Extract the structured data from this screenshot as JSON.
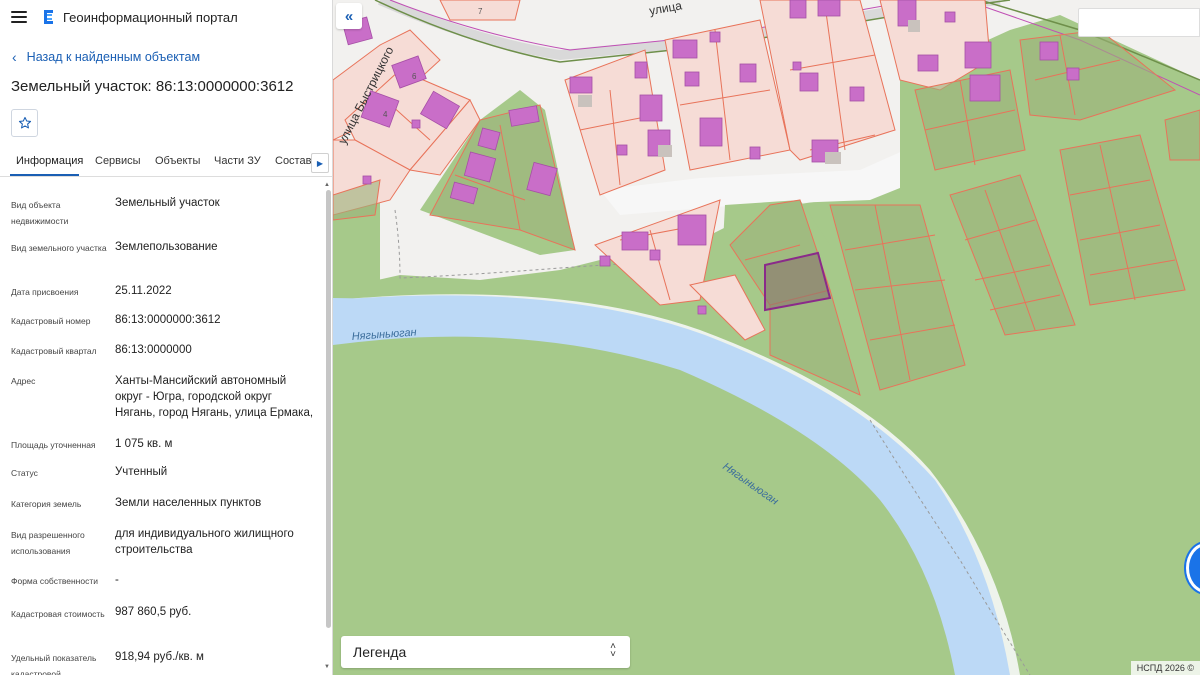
{
  "header": {
    "app_title": "Геоинформационный портал"
  },
  "nav": {
    "back_label": "Назад к найденным объектам"
  },
  "object": {
    "title": "Земельный участок: 86:13:0000000:3612"
  },
  "tabs": [
    {
      "label": "Информация",
      "active": true
    },
    {
      "label": "Сервисы"
    },
    {
      "label": "Объекты"
    },
    {
      "label": "Части ЗУ"
    },
    {
      "label": "Состав"
    }
  ],
  "properties": [
    {
      "label": "Вид объекта недвижимости",
      "value": "Земельный участок"
    },
    {
      "label": "Вид земельного участка",
      "value": "Землепользование"
    },
    {
      "label": "Дата присвоения",
      "value": "25.11.2022"
    },
    {
      "label": "Кадастровый номер",
      "value": "86:13:0000000:3612"
    },
    {
      "label": "Кадастровый квартал",
      "value": "86:13:0000000"
    },
    {
      "label": "Адрес",
      "value": "Ханты-Мансийский автономный округ - Югра, городской округ Нягань, город Нягань, улица Ермака,"
    },
    {
      "label": "Площадь уточненная",
      "value": "1 075 кв. м"
    },
    {
      "label": "Статус",
      "value": "Учтенный"
    },
    {
      "label": "Категория земель",
      "value": "Земли населенных пунктов"
    },
    {
      "label": "Вид разрешенного использования",
      "value": "для индивидуального жилищного строительства"
    },
    {
      "label": "Форма собственности",
      "value": "-"
    },
    {
      "label": "Кадастровая стоимость",
      "value": "987 860,5 руб."
    },
    {
      "label": "Удельный показатель кадастровой",
      "value": "918,94 руб./кв. м"
    }
  ],
  "map": {
    "street_label": "улица Быстрицкого",
    "street_label_top": "улица",
    "river_label_1": "Нягыньюган",
    "river_label_2": "Нягыньюган",
    "house_numbers": [
      "7",
      "6",
      "4"
    ],
    "legend_label": "Легенда",
    "copyright": "НСПД 2026 ©",
    "colors": {
      "grass": "#a6c98a",
      "river": "#bcd9f6",
      "parcel_outline": "#e8735a",
      "parcel_fill_urban": "#f6dcd6",
      "building": "#c96ec8",
      "selected": "#8a2a8a",
      "accent": "#1a5fb4"
    }
  },
  "icons": {
    "menu": "hamburger-icon",
    "logo": "portal-logo-icon",
    "back": "chevron-left-icon",
    "favorite": "star-icon",
    "tabs_next": "triangle-right-icon",
    "collapse": "double-chevron-left-icon",
    "legend_toggle": "sort-arrows-icon"
  }
}
